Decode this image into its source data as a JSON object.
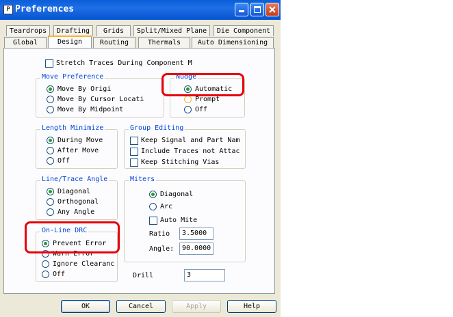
{
  "window": {
    "title": "Preferences",
    "icon_name": "app-icon",
    "icon_glyph": "P",
    "minimize_glyph": "_",
    "maximize_glyph": "□",
    "close_glyph": "✕"
  },
  "tabs": {
    "row1": [
      "Teardrops",
      "Drafting",
      "Grids",
      "Split/Mixed Plane",
      "Die Component"
    ],
    "row2": [
      "Global",
      "Design",
      "Routing",
      "Thermals",
      "Auto Dimensioning"
    ],
    "active": "Design"
  },
  "stretch": {
    "label": "Stretch Traces During Component M",
    "checked": false
  },
  "move_preference": {
    "title": "Move Preference",
    "options": [
      "Move By Origi",
      "Move By Cursor Locati",
      "Move By Midpoint"
    ],
    "selected": "Move By Origi"
  },
  "nudge": {
    "title": "Nudge",
    "options": [
      "Automatic",
      "Prompt",
      "Off"
    ],
    "selected": "Automatic"
  },
  "length_minimize": {
    "title": "Length Minimize",
    "options": [
      "During Move",
      "After Move",
      "Off"
    ],
    "selected": "During Move"
  },
  "group_editing": {
    "title": "Group Editing",
    "options": [
      "Keep Signal and Part Nam",
      "Include Traces not Attac",
      "Keep Stitching Vias"
    ],
    "checked": [
      false,
      false,
      false
    ]
  },
  "line_trace_angle": {
    "title": "Line/Trace Angle",
    "options": [
      "Diagonal",
      "Orthogonal",
      "Any Angle"
    ],
    "selected": "Diagonal"
  },
  "miters": {
    "title": "Miters",
    "options": [
      "Diagonal",
      "Arc"
    ],
    "selected": "Diagonal",
    "auto_miter_label": "Auto Mite",
    "auto_miter_checked": false,
    "ratio_label": "Ratio",
    "ratio_value": "3.5000",
    "angle_label": "Angle:",
    "angle_value": "90.0000"
  },
  "online_drc": {
    "title": "On-Line DRC",
    "options": [
      "Prevent Error",
      "Warn Error",
      "Ignore Clearanc",
      "Off"
    ],
    "selected": "Prevent Error"
  },
  "drill": {
    "label": "Drill",
    "value": "3"
  },
  "buttons": {
    "ok": "OK",
    "cancel": "Cancel",
    "apply": "Apply",
    "help": "Help"
  },
  "colors": {
    "highlight_box": "#e8000a",
    "group_title": "#0046d5",
    "title_bar": "#0a5ed8"
  }
}
